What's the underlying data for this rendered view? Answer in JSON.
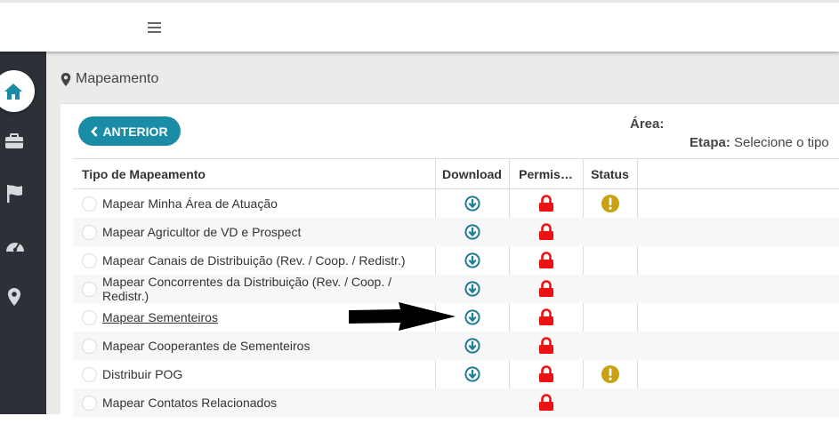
{
  "header": {
    "menu_icon": "hamburger-icon"
  },
  "sidebar": {
    "items": [
      {
        "icon": "home-icon",
        "active": true
      },
      {
        "icon": "briefcase-icon",
        "active": false
      },
      {
        "icon": "flag-icon",
        "active": false
      },
      {
        "icon": "dashboard-gauge-icon",
        "active": false
      },
      {
        "icon": "map-marker-icon",
        "active": false
      }
    ]
  },
  "breadcrumb": {
    "icon": "map-marker-icon",
    "label": "Mapeamento"
  },
  "toolbar": {
    "back_label": "ANTERIOR",
    "area_label": "Área:",
    "etapa_label": "Etapa:",
    "etapa_value": "Selecione o tipo"
  },
  "table": {
    "columns": [
      "Tipo de Mapeamento",
      "Download",
      "Permis…",
      "Status"
    ],
    "rows": [
      {
        "name": "Mapear Minha Área de Atuação",
        "download": true,
        "locked": true,
        "status": "warning"
      },
      {
        "name": "Mapear Agricultor de VD e Prospect",
        "download": true,
        "locked": true,
        "status": ""
      },
      {
        "name": "Mapear Canais de Distribuição (Rev. / Coop. / Redistr.)",
        "download": true,
        "locked": true,
        "status": ""
      },
      {
        "name": "Mapear Concorrentes da Distribuição (Rev. / Coop. / Redistr.)",
        "download": true,
        "locked": true,
        "status": ""
      },
      {
        "name": "Mapear Sementeiros",
        "download": true,
        "locked": true,
        "status": "",
        "underline": true
      },
      {
        "name": "Mapear Cooperantes de Sementeiros",
        "download": true,
        "locked": true,
        "status": ""
      },
      {
        "name": "Distribuir POG",
        "download": true,
        "locked": true,
        "status": "warning"
      },
      {
        "name": "Mapear Contatos Relacionados",
        "download": false,
        "locked": true,
        "status": ""
      }
    ]
  },
  "colors": {
    "accent": "#1b8ca6",
    "lock": "#ee1111",
    "warning": "#c9a214",
    "sidebar": "#2c3037",
    "download_icon": "#1f7d95"
  }
}
